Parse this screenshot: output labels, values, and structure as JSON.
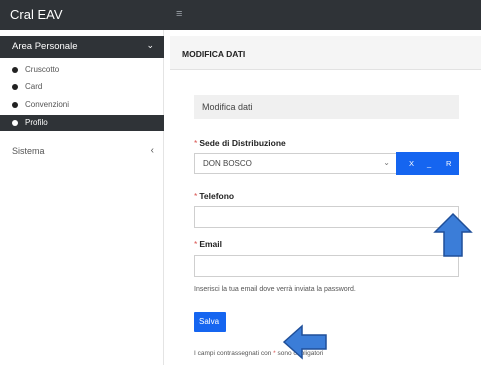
{
  "app": {
    "title": "Cral EAV"
  },
  "topbar": {
    "menu_icon": "hamburger-icon"
  },
  "sidebar": {
    "section": {
      "label": "Area Personale",
      "icon": "chevron-down-icon"
    },
    "items": [
      {
        "label": "Cruscotto"
      },
      {
        "label": "Card"
      },
      {
        "label": "Convenzioni"
      },
      {
        "label": "Profilo",
        "active": true
      }
    ],
    "system": {
      "label": "Sistema",
      "icon": "chevron-left-icon"
    }
  },
  "page": {
    "title": "MODIFICA DATI"
  },
  "form": {
    "subheading": "Modifica dati",
    "required_mark": "*",
    "sede": {
      "label": "Sede di Distribuzione",
      "value": "DON BOSCO",
      "button_labels": [
        "X",
        "_",
        "R"
      ]
    },
    "telefono": {
      "label": "Telefono",
      "value": ""
    },
    "email": {
      "label": "Email",
      "value": "",
      "help": "Inserisci la tua email dove verrà inviata la password."
    },
    "save_label": "Salva",
    "footnote": {
      "prefix": "I campi contrassegnati con",
      "suffix": "sono obbligatori"
    }
  },
  "colors": {
    "dark": "#2f3337",
    "primary": "#1565f0",
    "arrow": "#3b7dd8",
    "required": "#d9534f"
  }
}
